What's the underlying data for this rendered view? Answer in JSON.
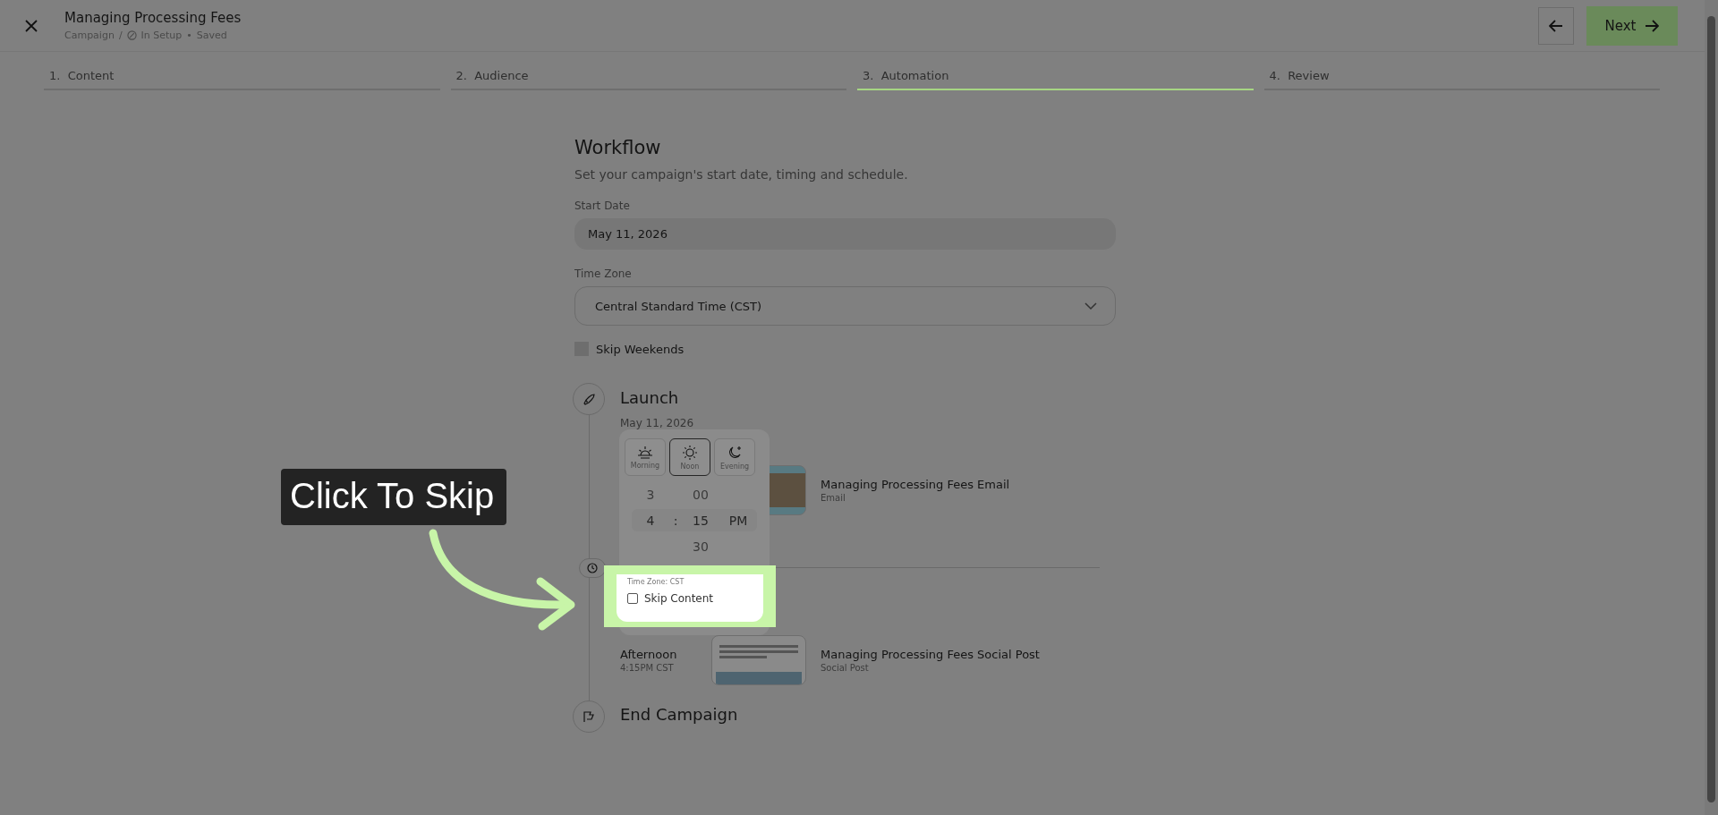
{
  "header": {
    "title": "Managing Processing Fees",
    "breadcrumb": "Campaign",
    "separator": "/",
    "status": "In Setup",
    "dot": "•",
    "saved": "Saved"
  },
  "nav": {
    "next_label": "Next"
  },
  "steps": [
    {
      "number": "1.",
      "label": "Content",
      "selected": false
    },
    {
      "number": "2.",
      "label": "Audience",
      "selected": false
    },
    {
      "number": "3.",
      "label": "Automation",
      "selected": true
    },
    {
      "number": "4.",
      "label": "Review",
      "selected": false
    }
  ],
  "workflow": {
    "title": "Workflow",
    "subtitle": "Set your campaign's start date, timing and schedule.",
    "start_date": {
      "label": "Start Date",
      "value": "May 11, 2026"
    },
    "time_zone": {
      "label": "Time Zone",
      "value": "Central Standard Time (CST)"
    },
    "skip_weekends": {
      "label": "Skip Weekends",
      "checked": false
    }
  },
  "timeline": {
    "launch": {
      "title": "Launch",
      "date": "May 11, 2026"
    },
    "items": [
      {
        "kind": "email",
        "title": "Managing Processing Fees Email",
        "type": "Email"
      },
      {
        "kind": "social",
        "slot": "Afternoon",
        "time": "4:15PM CST",
        "title": "Managing Processing Fees Social Post",
        "type": "Social Post"
      }
    ],
    "end": {
      "title": "End Campaign"
    }
  },
  "time_picker": {
    "periods": [
      {
        "label": "Morning",
        "selected": false
      },
      {
        "label": "Noon",
        "selected": true
      },
      {
        "label": "Evening",
        "selected": false
      }
    ],
    "hours": [
      {
        "value": "3",
        "selected": false
      },
      {
        "value": "4",
        "selected": true
      }
    ],
    "separator": ":",
    "minutes": [
      {
        "value": "00",
        "selected": false
      },
      {
        "value": "15",
        "selected": true
      },
      {
        "value": "30",
        "selected": false
      }
    ],
    "meridiem": "PM",
    "time_zone": "Time Zone: CST",
    "skip_content": {
      "label": "Skip Content",
      "checked": false
    }
  },
  "callout": {
    "text": "Click To Skip"
  }
}
